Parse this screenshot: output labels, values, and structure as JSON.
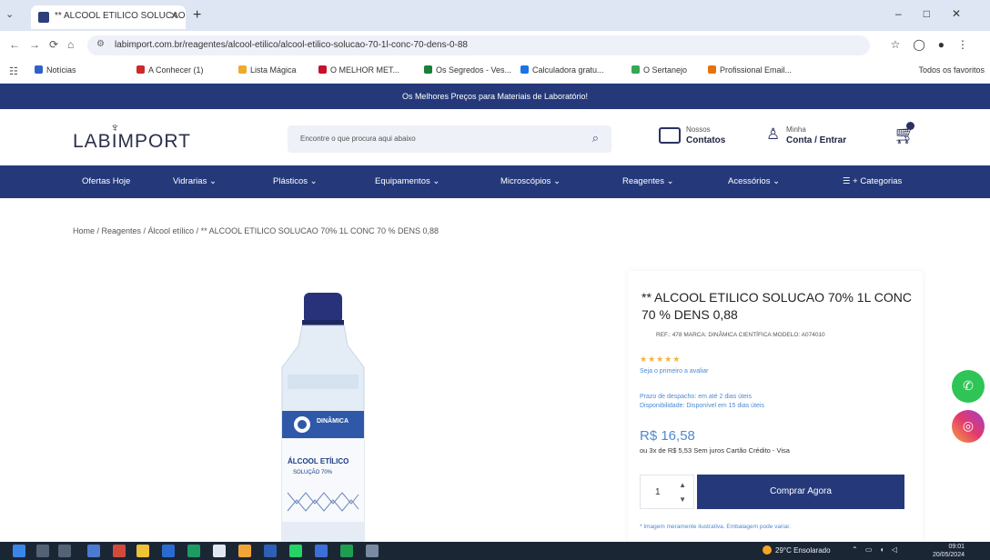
{
  "browser": {
    "tab_title": "** ALCOOL ETILICO SOLUCAO",
    "url": "labimport.com.br/reagentes/alcool-etilico/alcool-etilico-solucao-70-1l-conc-70-dens-0-88",
    "bookmarks": [
      {
        "label": "Notícias",
        "color": "#2d62c8"
      },
      {
        "label": "A Conhecer (1)",
        "color": "#cc2a2a"
      },
      {
        "label": "Lista Mágica",
        "color": "#f0a928"
      },
      {
        "label": "O MELHOR MET...",
        "color": "#c8102e"
      },
      {
        "label": "Os Segredos - Ves...",
        "color": "#188038"
      },
      {
        "label": "Calculadora gratu...",
        "color": "#1a73e8"
      },
      {
        "label": "O Sertanejo",
        "color": "#34a853"
      },
      {
        "label": "Profissional Email...",
        "color": "#e8710a"
      }
    ],
    "bookmarks_right": "Todos os favoritos"
  },
  "site": {
    "promo_text": "Os Melhores Preços para Materiais de Laboratório!",
    "logo": "LABIMPORT",
    "search_placeholder": "Encontre o que procura aqui abaixo",
    "contact": {
      "line1": "Nossos",
      "line2": "Contatos"
    },
    "account": {
      "line1": "Minha",
      "line2": "Conta / Entrar"
    },
    "nav": [
      {
        "label": "Ofertas Hoje"
      },
      {
        "label": "Vidrarias ⌄"
      },
      {
        "label": "Plásticos ⌄"
      },
      {
        "label": "Equipamentos ⌄"
      },
      {
        "label": "Microscópios ⌄"
      },
      {
        "label": "Reagentes ⌄"
      },
      {
        "label": "Acessórios ⌄"
      },
      {
        "label": "☰ + Categorias"
      }
    ],
    "breadcrumb": "Home  /  Reagentes  /  Álcool etílico  /  ** ALCOOL ETILICO SOLUCAO 70% 1L CONC 70 % DENS 0,88"
  },
  "product": {
    "title": "** ALCOOL ETILICO SOLUCAO 70% 1L CONC 70 % DENS 0,88",
    "meta": "REF.: 478   MARCA: DINÂMICA CIENTÍFICA   MODELO: A074010",
    "stars": "★★★★★",
    "review_link": "Seja o primeiro a avaliar",
    "delivery_line1": "Prazo de despacho: em até 2 dias úteis",
    "delivery_line2": "Disponibilidade: Disponível em 15 dias úteis",
    "price": "R$ 16,58",
    "installments": "ou 3x de R$ 5,53 Sem juros Cartão Crédito - Visa",
    "quantity": "1",
    "buy_label": "Comprar Agora",
    "note": "* Imagem meramente ilustrativa. Embalagem pode variar."
  },
  "bottle_label": {
    "brand": "DINÂMICA",
    "line1": "ÁLCOOL ETÍLICO",
    "line2": "SOLUÇÃO 70%"
  },
  "taskbar": {
    "weather": "29°C  Ensolarado",
    "time": "09:01",
    "date": "20/05/2024"
  },
  "colors": {
    "brand_navy": "#25397a",
    "price_blue": "#4c8ad1",
    "whatsapp": "#2fc456"
  }
}
